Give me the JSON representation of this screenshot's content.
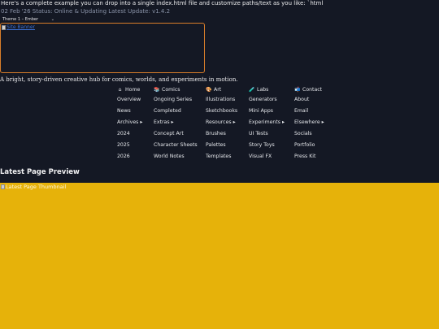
{
  "intro_text": "Here's a complete example you can drop into a single index.html file and customize paths/text as you like: `html",
  "status_line": "02 Feb '26 Status: Online & Updating Latest Update: v1.4.2",
  "theme_select": {
    "selected": "Theme 1 – Ember"
  },
  "banner": {
    "alt": "Site Banner"
  },
  "tagline": "A bright, story-driven creative hub for comics, worlds, and experiments in motion.",
  "nav": {
    "columns": [
      {
        "icon": "home-icon",
        "glyph": "⌂",
        "title": "Home",
        "items": [
          "Overview",
          "News",
          "Archives ▸",
          "2024",
          "2025",
          "2026"
        ]
      },
      {
        "icon": "comics-icon",
        "glyph": "📚",
        "title": "Comics",
        "items": [
          "Ongoing Series",
          "Completed",
          "Extras ▸",
          "Concept Art",
          "Character Sheets",
          "World Notes"
        ]
      },
      {
        "icon": "palette-icon",
        "glyph": "🎨",
        "title": "Art",
        "items": [
          "Illustrations",
          "Sketchbooks",
          "Resources ▸",
          "Brushes",
          "Palettes",
          "Templates"
        ]
      },
      {
        "icon": "labs-icon",
        "glyph": "🧪",
        "title": "Labs",
        "items": [
          "Generators",
          "Mini Apps",
          "Experiments ▸",
          "UI Tests",
          "Story Toys",
          "Visual FX"
        ]
      },
      {
        "icon": "contact-icon",
        "glyph": "📬",
        "title": "Contact",
        "items": [
          "About",
          "Email",
          "Elsewhere ▸",
          "Socials",
          "Portfolio",
          "Press Kit"
        ]
      }
    ]
  },
  "preview": {
    "title": "Latest Page Preview",
    "thumb_alt": "Latest Page Thumbnail"
  },
  "colors": {
    "background": "#141824",
    "banner_border": "#d97e2a",
    "preview_bg": "#e6b20a"
  }
}
